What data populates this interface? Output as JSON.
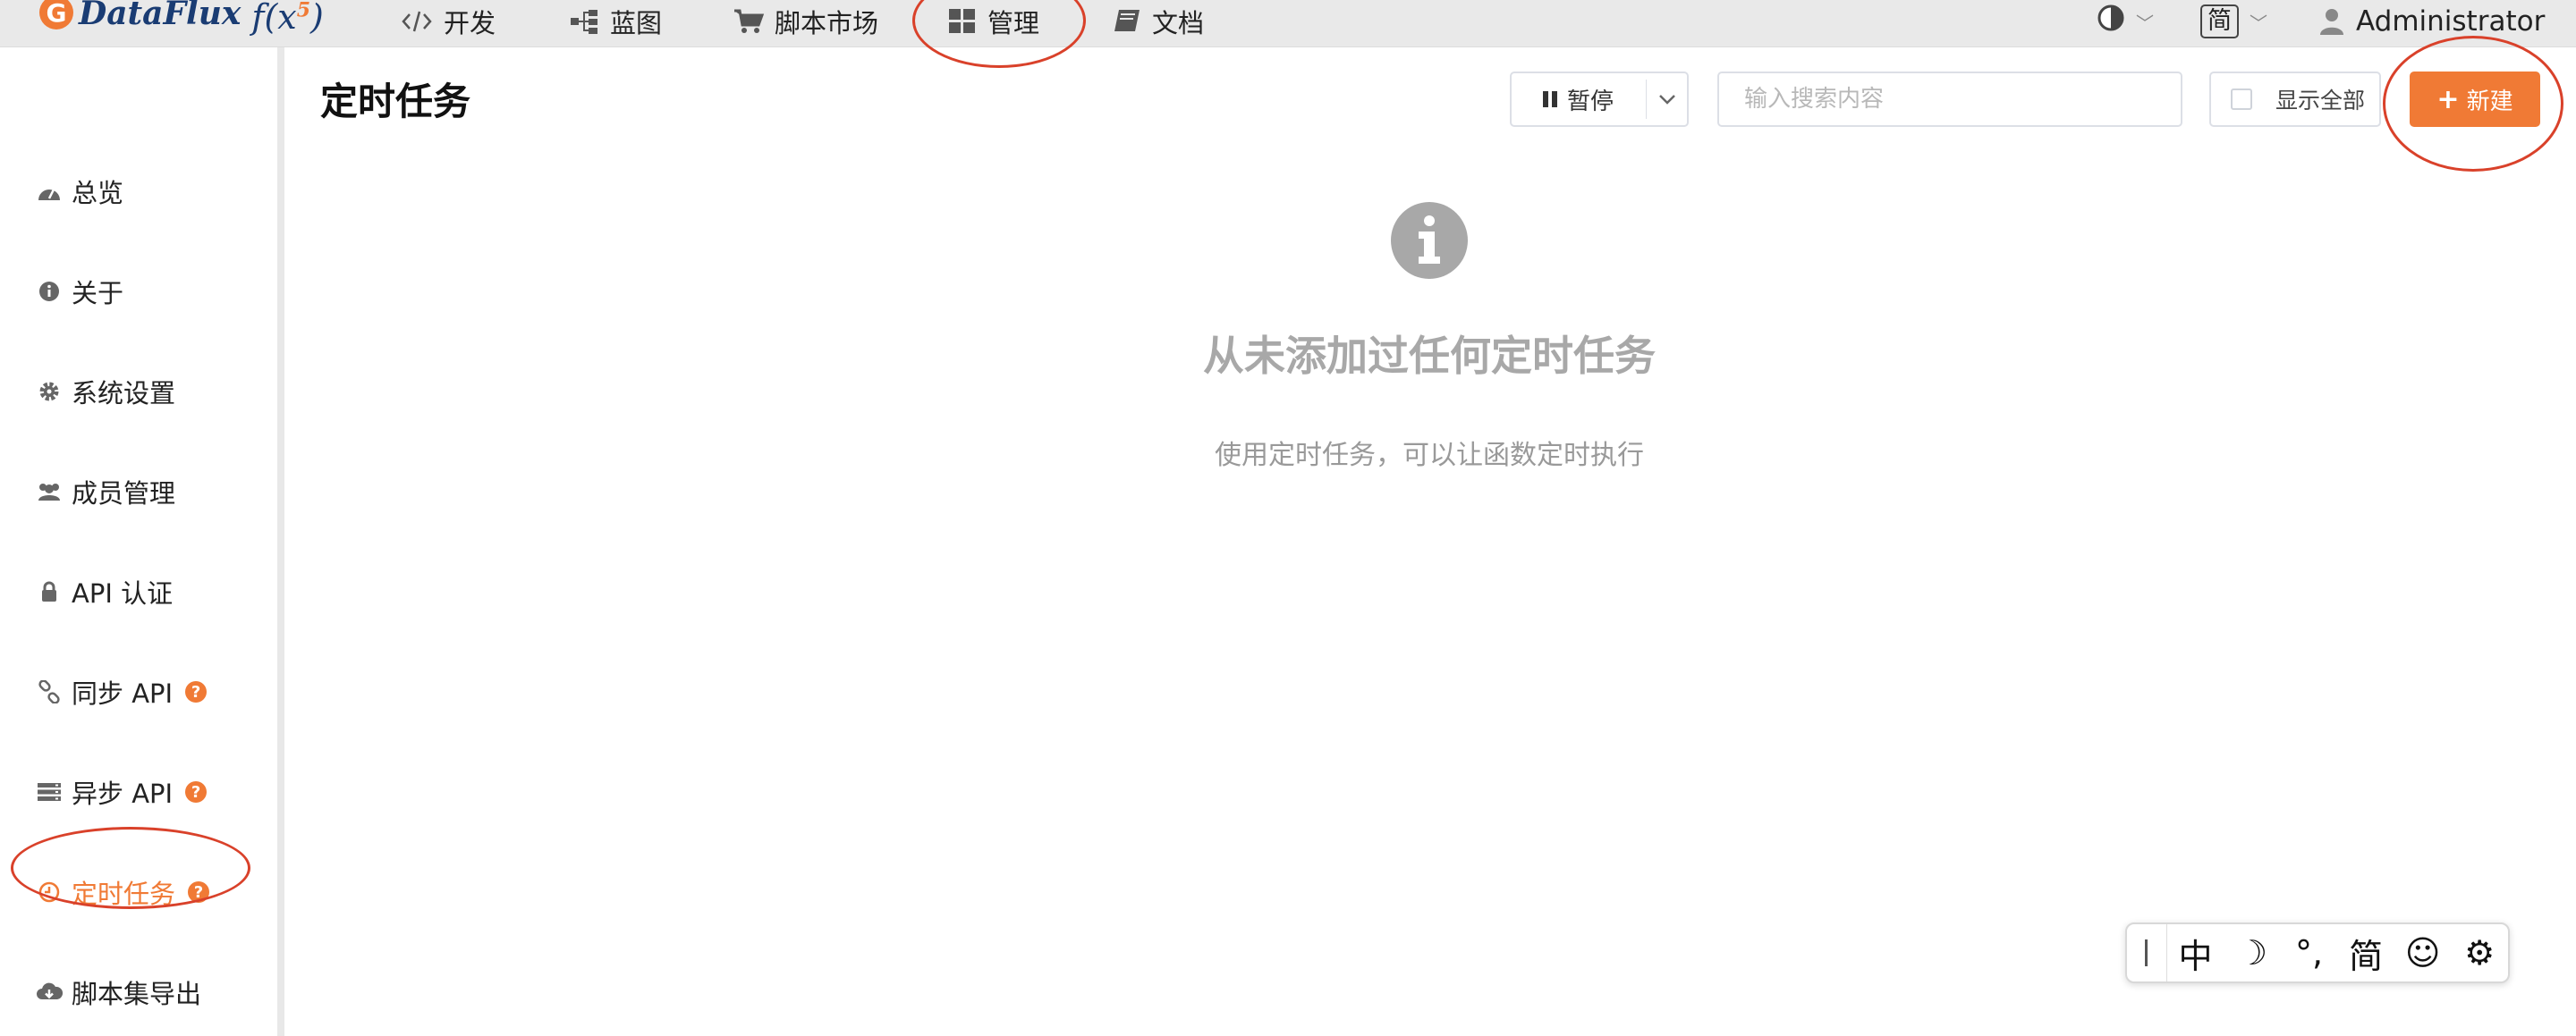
{
  "app": {
    "name": "DataFlux",
    "fx": "f(x",
    "fx_sup": "5",
    "fx_close": ")"
  },
  "nav": {
    "items": [
      {
        "label": "开发",
        "icon": "code-icon"
      },
      {
        "label": "蓝图",
        "icon": "blueprint-icon"
      },
      {
        "label": "脚本市场",
        "icon": "cart-icon"
      },
      {
        "label": "管理",
        "icon": "grid-icon"
      },
      {
        "label": "文档",
        "icon": "book-icon"
      }
    ]
  },
  "topright": {
    "theme_icon": "contrast-icon",
    "language": "简",
    "user": "Administrator"
  },
  "sidebar": {
    "items": [
      {
        "label": "总览",
        "icon": "dashboard-icon"
      },
      {
        "label": "关于",
        "icon": "info-icon"
      },
      {
        "label": "系统设置",
        "icon": "gear-icon"
      },
      {
        "label": "成员管理",
        "icon": "users-icon"
      },
      {
        "label": "API 认证",
        "icon": "lock-icon"
      },
      {
        "label": "同步 API",
        "icon": "link-icon",
        "help": true
      },
      {
        "label": "异步 API",
        "icon": "server-icon",
        "help": true
      },
      {
        "label": "定时任务",
        "icon": "clock-icon",
        "help": true,
        "active": true
      },
      {
        "label": "脚本集导出",
        "icon": "cloud-download-icon"
      }
    ]
  },
  "main": {
    "title": "定时任务",
    "pause_label": "暂停",
    "search_placeholder": "输入搜索内容",
    "show_all_label": "显示全部",
    "new_label": "新建",
    "empty_title": "从未添加过任何定时任务",
    "empty_subtitle": "使用定时任务，可以让函数定时执行"
  },
  "ime": {
    "items": [
      "中",
      "☽",
      "°,",
      "简",
      "☺",
      "⚙"
    ]
  },
  "colors": {
    "accent": "#f07a35",
    "annotation": "#d9412a",
    "logo_blue": "#1a3c73"
  }
}
